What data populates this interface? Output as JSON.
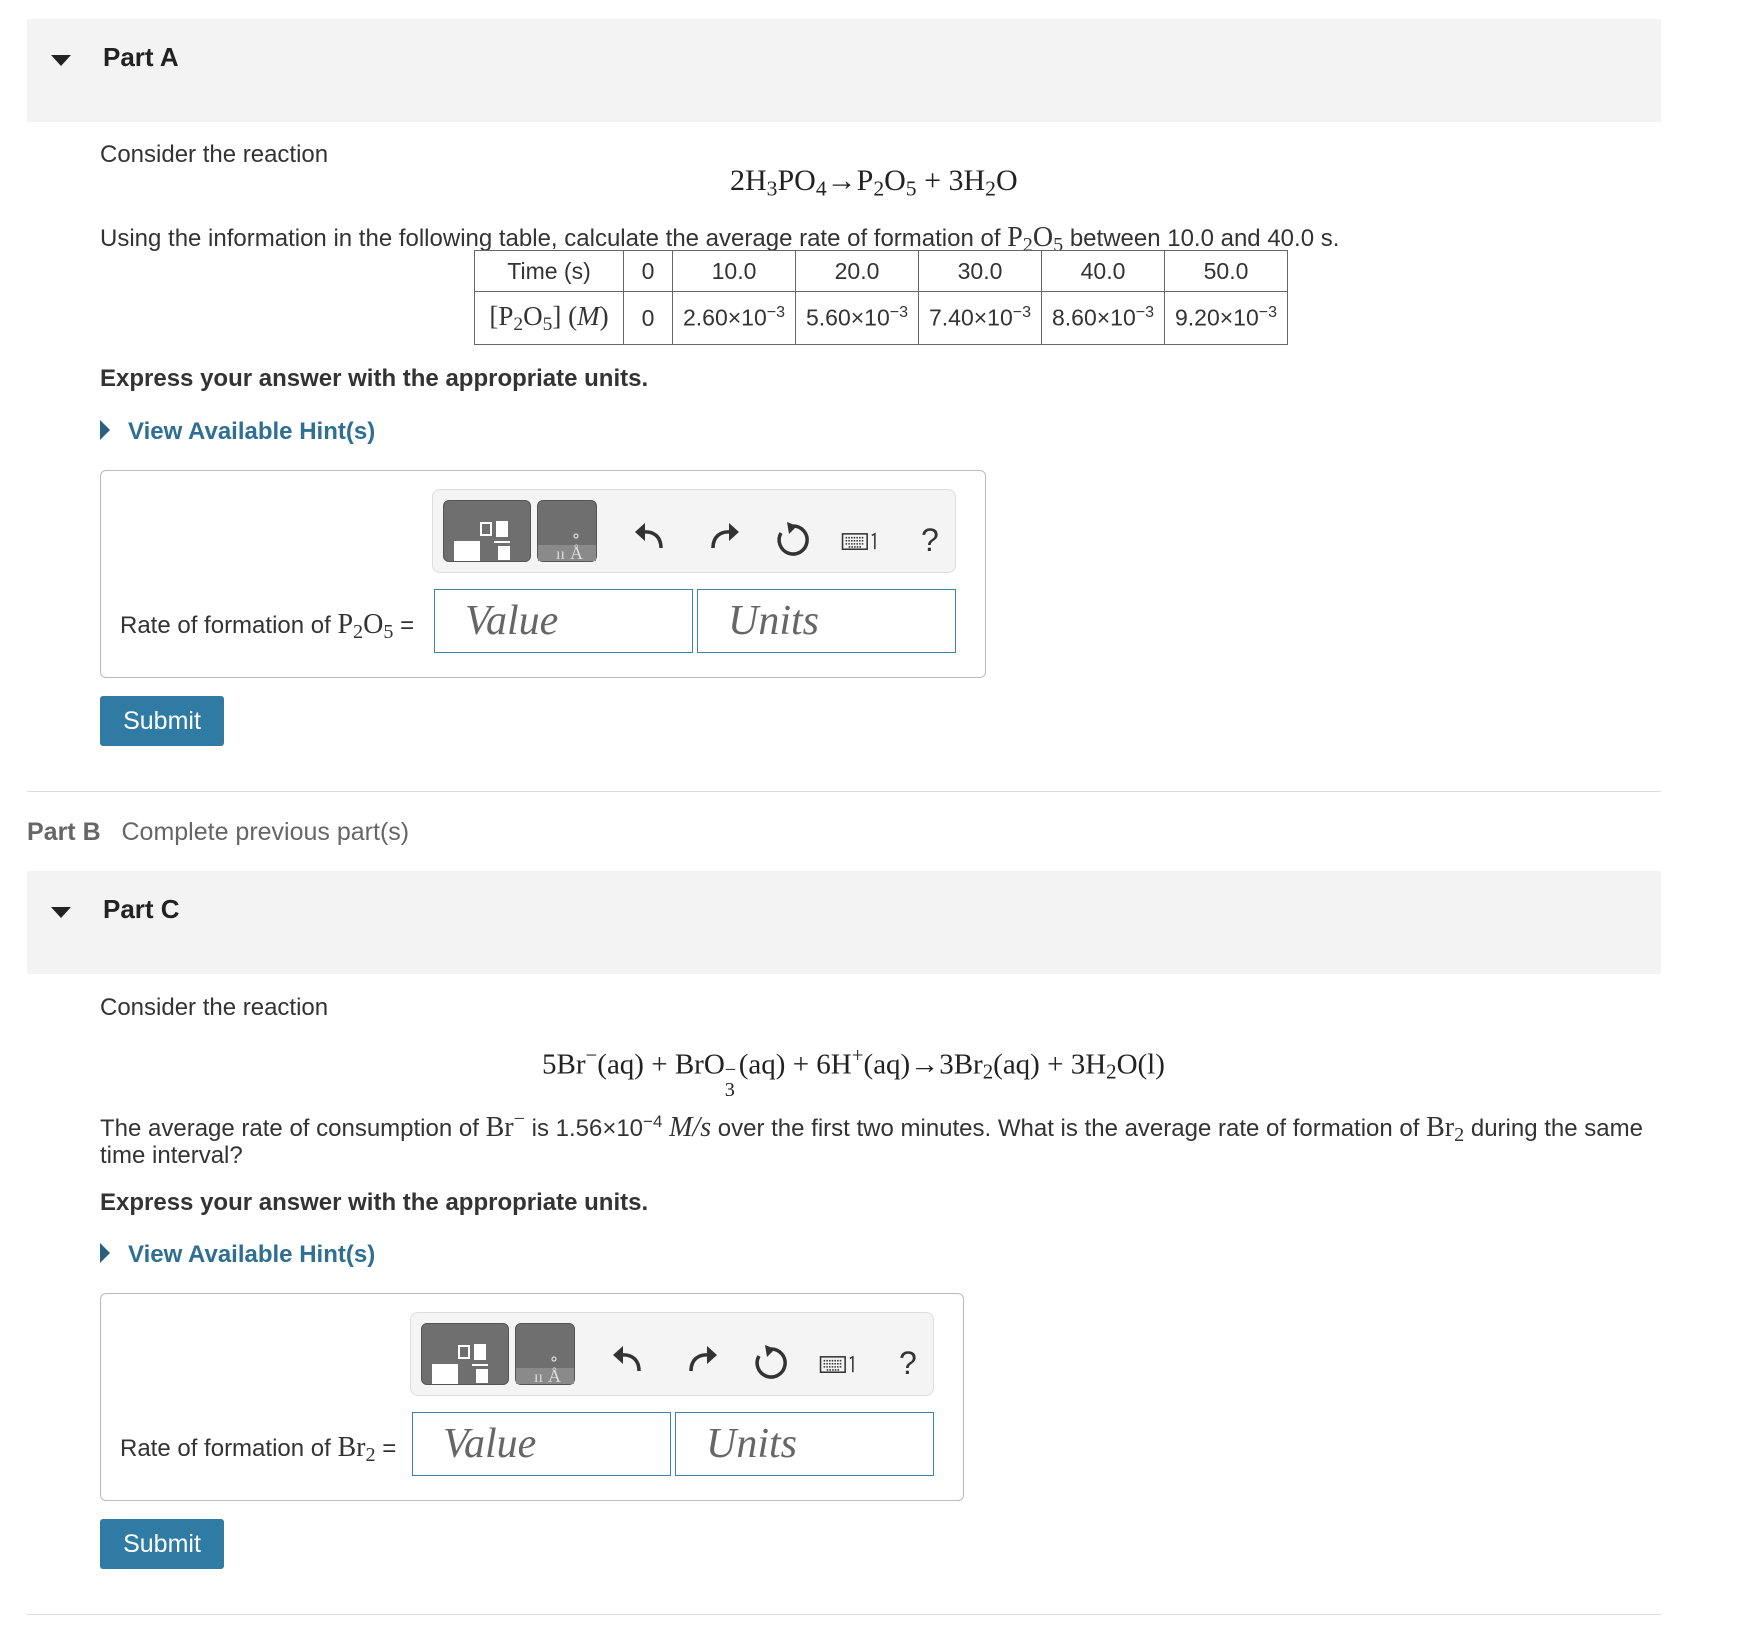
{
  "partA": {
    "title": "Part A",
    "intro": "Consider the reaction",
    "equation": {
      "lhs": "2H",
      "a": "3",
      "b": "PO",
      "c": "4",
      "arrow": "→",
      "d": "P",
      "e": "2",
      "f": "O",
      "g": "5",
      "plus": " + 3H",
      "h": "2",
      "i": "O"
    },
    "question_pre": "Using the information in the following table, calculate the average rate of formation of",
    "question_species": {
      "p": "P",
      "s1": "2",
      "o": "O",
      "s2": "5"
    },
    "question_post": "between 10.0 and 40.0 s.",
    "table": {
      "row1_header": "Time (s)",
      "times": [
        "0",
        "10.0",
        "20.0",
        "30.0",
        "40.0",
        "50.0"
      ],
      "row2_header": {
        "open": "[P",
        "s1": "2",
        "o": "O",
        "s2": "5",
        "close": "] (",
        "m": "M",
        "end": ")"
      },
      "concentrations": [
        {
          "mant": "0",
          "exp": ""
        },
        {
          "mant": "2.60×10",
          "exp": "−3"
        },
        {
          "mant": "5.60×10",
          "exp": "−3"
        },
        {
          "mant": "7.40×10",
          "exp": "−3"
        },
        {
          "mant": "8.60×10",
          "exp": "−3"
        },
        {
          "mant": "9.20×10",
          "exp": "−3"
        }
      ]
    },
    "express": "Express your answer with the appropriate units.",
    "hint": "View Available Hint(s)",
    "answer_label_pre": "Rate of formation of",
    "answer_species": {
      "p": "P",
      "s1": "2",
      "o": "O",
      "s2": "5"
    },
    "equals": "=",
    "value_placeholder": "Value",
    "units_placeholder": "Units",
    "submit": "Submit",
    "help": "?"
  },
  "partB": {
    "title": "Part B",
    "status": "Complete previous part(s)"
  },
  "partC": {
    "title": "Part C",
    "intro": "Consider the reaction",
    "equation": {
      "t1": "5Br",
      "t1sup": "−",
      "t2": "(aq) + BrO",
      "t2sub": "3",
      "t2sup": "−",
      "t3": "(aq) + 6H",
      "t3sup": "+",
      "t4": "(aq)→3Br",
      "t4sub": "2",
      "t5": "(aq) + 3H",
      "t5sub": "2",
      "t6": "O(l)"
    },
    "q_pre": "The average rate of consumption of",
    "q_br": "Br",
    "q_br_sup": "−",
    "q_mid": "is 1.56×10",
    "q_exp": "−4",
    "q_unit": "M/s",
    "q_post": "over the first two minutes. What is the average rate of formation of",
    "q_br2": "Br",
    "q_br2_sub": "2",
    "q_end": "during the same",
    "q_line2": "time interval?",
    "express": "Express your answer with the appropriate units.",
    "hint": "View Available Hint(s)",
    "answer_label_pre": "Rate of formation of",
    "answer_species": {
      "b": "Br",
      "s": "2"
    },
    "equals": "=",
    "value_placeholder": "Value",
    "units_placeholder": "Units",
    "submit": "Submit",
    "help": "?"
  },
  "icons": [
    "caret-down-icon",
    "caret-right-icon",
    "templates-icon",
    "symbols-icon",
    "undo-icon",
    "redo-icon",
    "reset-icon",
    "keyboard-icon",
    "help-icon"
  ],
  "colors": {
    "header_bg": "#f3f3f3",
    "link": "#2e6f93",
    "submit_bg": "#2f7ba3",
    "input_border": "#3d82a8"
  }
}
